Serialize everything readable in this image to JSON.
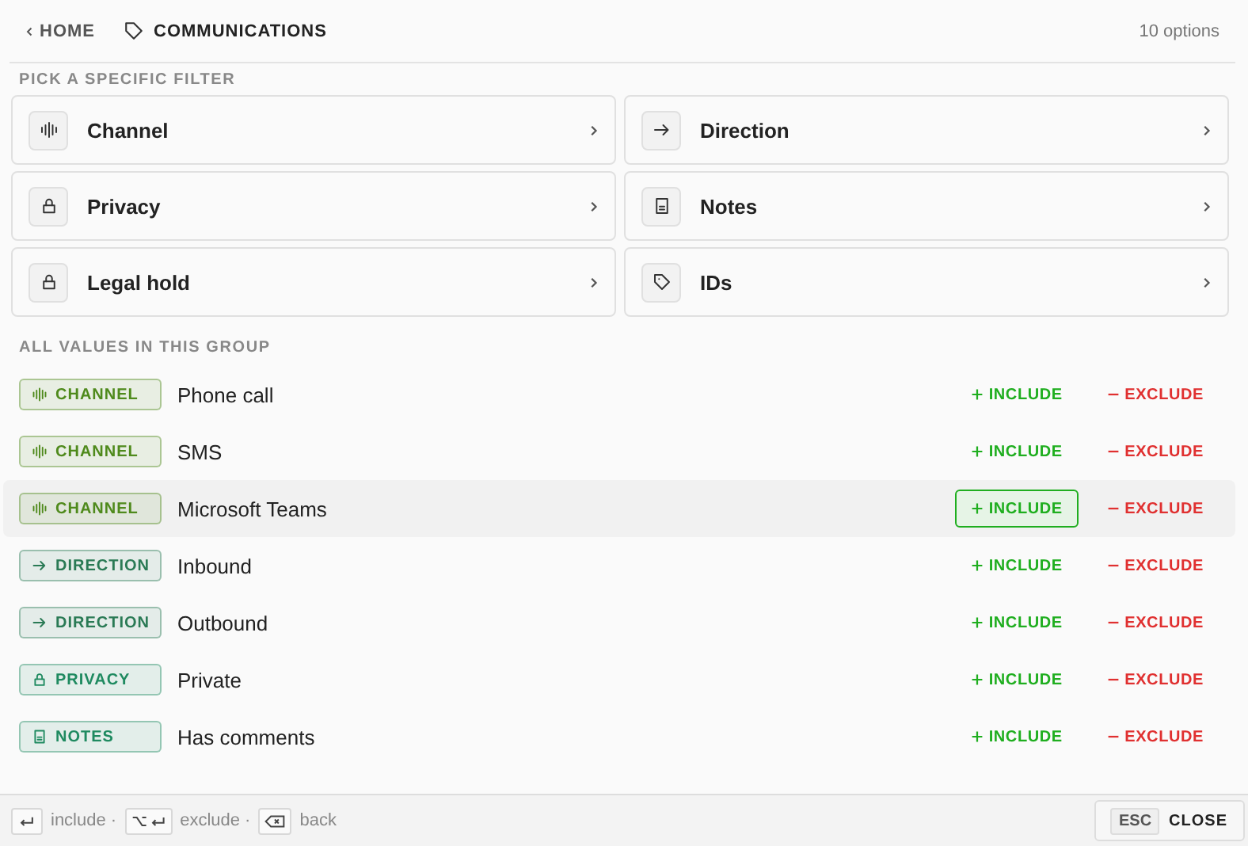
{
  "breadcrumb": {
    "back": "HOME",
    "current": "COMMUNICATIONS",
    "count": "10 options"
  },
  "filters": {
    "heading": "PICK A SPECIFIC FILTER",
    "items": [
      {
        "label": "Channel",
        "kind": "channel"
      },
      {
        "label": "Direction",
        "kind": "direction"
      },
      {
        "label": "Privacy",
        "kind": "privacy"
      },
      {
        "label": "Notes",
        "kind": "notes"
      },
      {
        "label": "Legal hold",
        "kind": "privacy"
      },
      {
        "label": "IDs",
        "kind": "ids"
      }
    ]
  },
  "values": {
    "heading": "ALL VALUES IN THIS GROUP",
    "rows": [
      {
        "tag": "CHANNEL",
        "kind": "channel",
        "color": "#4f8a1c",
        "label": "Phone call",
        "include": "INCLUDE",
        "exclude": "EXCLUDE",
        "selected": false
      },
      {
        "tag": "CHANNEL",
        "kind": "channel",
        "color": "#4f8a1c",
        "label": "SMS",
        "include": "INCLUDE",
        "exclude": "EXCLUDE",
        "selected": false
      },
      {
        "tag": "CHANNEL",
        "kind": "channel",
        "color": "#4f8a1c",
        "label": "Microsoft Teams",
        "include": "INCLUDE",
        "exclude": "EXCLUDE",
        "selected": true
      },
      {
        "tag": "DIRECTION",
        "kind": "direction",
        "color": "#2a7a55",
        "label": "Inbound",
        "include": "INCLUDE",
        "exclude": "EXCLUDE",
        "selected": false
      },
      {
        "tag": "DIRECTION",
        "kind": "direction",
        "color": "#2a7a55",
        "label": "Outbound",
        "include": "INCLUDE",
        "exclude": "EXCLUDE",
        "selected": false
      },
      {
        "tag": "PRIVACY",
        "kind": "privacy",
        "color": "#1f8a60",
        "label": "Private",
        "include": "INCLUDE",
        "exclude": "EXCLUDE",
        "selected": false
      },
      {
        "tag": "NOTES",
        "kind": "notes",
        "color": "#1f8a60",
        "label": "Has comments",
        "include": "INCLUDE",
        "exclude": "EXCLUDE",
        "selected": false
      }
    ]
  },
  "footer": {
    "hints": [
      {
        "kind": "enter",
        "label": "include ·"
      },
      {
        "kind": "option",
        "label": "exclude ·"
      },
      {
        "kind": "backspace",
        "label": "back"
      }
    ],
    "esc": "ESC",
    "close": "CLOSE"
  }
}
